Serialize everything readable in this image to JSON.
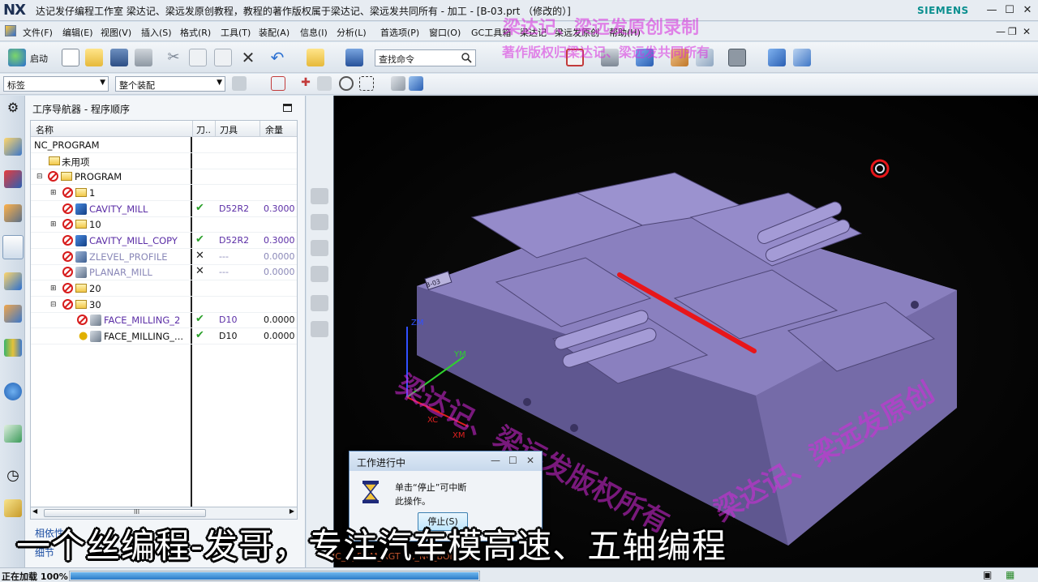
{
  "app": {
    "logo": "NX",
    "title": "达记发仔编程工作室  梁达记、梁远发原创教程，教程的著作版权属于梁达记、梁远发共同所有 - 加工 - [B-03.prt （修改的）]",
    "brand": "SIEMENS"
  },
  "menu": {
    "items": [
      "文件(F)",
      "编辑(E)",
      "视图(V)",
      "插入(S)",
      "格式(R)",
      "工具(T)",
      "装配(A)",
      "信息(I)",
      "分析(L)",
      "首选项(P)",
      "窗口(O)",
      "GC工具箱",
      "梁达记",
      "梁远发原创",
      "帮助(H)"
    ]
  },
  "toolbar": {
    "start_label": "启动",
    "search_placeholder": "查找命令",
    "filter_combo": "标签",
    "assembly_combo": "整个装配"
  },
  "navigator": {
    "title": "工序导航器 - 程序顺序",
    "columns": [
      "名称",
      "刀..",
      "刀具",
      "余量"
    ],
    "rows": [
      {
        "name": "NC_PROGRAM",
        "check": "",
        "tool": "",
        "stock": ""
      },
      {
        "name": "未用项",
        "check": "",
        "tool": "",
        "stock": ""
      },
      {
        "name": "PROGRAM",
        "check": "",
        "tool": "",
        "stock": ""
      },
      {
        "name": "1",
        "check": "",
        "tool": "",
        "stock": ""
      },
      {
        "name": "CAVITY_MILL",
        "check": "✔",
        "tool": "D52R2",
        "stock": "0.3000"
      },
      {
        "name": "10",
        "check": "",
        "tool": "",
        "stock": ""
      },
      {
        "name": "CAVITY_MILL_COPY",
        "check": "✔",
        "tool": "D52R2",
        "stock": "0.3000"
      },
      {
        "name": "ZLEVEL_PROFILE",
        "check": "✕",
        "tool": "---",
        "stock": "0.0000"
      },
      {
        "name": "PLANAR_MILL",
        "check": "✕",
        "tool": "---",
        "stock": "0.0000"
      },
      {
        "name": "20",
        "check": "",
        "tool": "",
        "stock": ""
      },
      {
        "name": "30",
        "check": "",
        "tool": "",
        "stock": ""
      },
      {
        "name": "FACE_MILLING_2",
        "check": "✔",
        "tool": "D10",
        "stock": "0.0000"
      },
      {
        "name": "FACE_MILLING_...",
        "check": "✔",
        "tool": "D10",
        "stock": "0.0000"
      }
    ],
    "scroll_grip": "III",
    "tabs": [
      "相依性",
      "细节"
    ]
  },
  "viewport": {
    "axis_labels": {
      "zm": "ZM",
      "ym": "YM",
      "xc": "XC",
      "xm": "XM"
    },
    "bottom_label": "JC_N_BOM_RGT  XC_NC_BOM_RGT",
    "part_stamp": "B-03"
  },
  "watermarks": {
    "top1": "梁达记、梁远发原创录制",
    "top2": "著作版权归梁达记、梁远发共同所有",
    "diagonal1": "梁达记、梁远发版权所有",
    "diagonal2": "梁达记、梁远发原创"
  },
  "dialog": {
    "title": "工作进行中",
    "message_line1": "单击“停止”可中断",
    "message_line2": "此操作。",
    "stop_button": "停止(S)"
  },
  "caption": "一个丝编程-发哥，专注汽车模高速、五轴编程",
  "status": {
    "text": "正在加载 100%",
    "progress": 1.0
  },
  "colors": {
    "model": "#7f73b4",
    "toolpath": "#e8161a",
    "watermark": "#d728dc",
    "brand": "#0a8f8f"
  }
}
